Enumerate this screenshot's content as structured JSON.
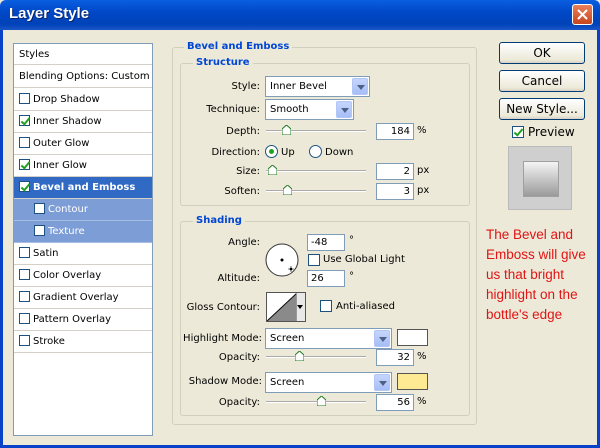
{
  "window": {
    "title": "Layer Style"
  },
  "sidebar": {
    "header": "Styles",
    "items": [
      {
        "label": "Blending Options: Custom",
        "checked": null
      },
      {
        "label": "Drop Shadow",
        "checked": false
      },
      {
        "label": "Inner Shadow",
        "checked": true
      },
      {
        "label": "Outer Glow",
        "checked": false
      },
      {
        "label": "Inner Glow",
        "checked": true
      },
      {
        "label": "Bevel and Emboss",
        "checked": true,
        "selected": true
      },
      {
        "label": "Contour",
        "checked": false,
        "sub": true
      },
      {
        "label": "Texture",
        "checked": false,
        "sub": true
      },
      {
        "label": "Satin",
        "checked": false
      },
      {
        "label": "Color Overlay",
        "checked": false
      },
      {
        "label": "Gradient Overlay",
        "checked": false
      },
      {
        "label": "Pattern Overlay",
        "checked": false
      },
      {
        "label": "Stroke",
        "checked": false
      }
    ]
  },
  "bevel": {
    "group_title": "Bevel and Emboss",
    "structure": {
      "title": "Structure",
      "style_label": "Style:",
      "style_value": "Inner Bevel",
      "technique_label": "Technique:",
      "technique_value": "Smooth",
      "depth_label": "Depth:",
      "depth_value": "184",
      "depth_unit": "%",
      "depth_slider": 0.18,
      "direction_label": "Direction:",
      "dir_up": "Up",
      "dir_down": "Down",
      "direction_selected": "Up",
      "size_label": "Size:",
      "size_value": "2",
      "size_unit": "px",
      "size_slider": 0.02,
      "soften_label": "Soften:",
      "soften_value": "3",
      "soften_unit": "px",
      "soften_slider": 0.19
    },
    "shading": {
      "title": "Shading",
      "angle_label": "Angle:",
      "angle_value": "-48",
      "angle_unit": "°",
      "global_light_label": "Use Global Light",
      "global_light": false,
      "altitude_label": "Altitude:",
      "altitude_value": "26",
      "altitude_unit": "°",
      "gloss_label": "Gloss Contour:",
      "antialiased_label": "Anti-aliased",
      "antialiased": false,
      "highlight_label": "Highlight Mode:",
      "highlight_value": "Screen",
      "highlight_color": "#ffffff",
      "hl_opacity_label": "Opacity:",
      "hl_opacity_value": "32",
      "hl_opacity_unit": "%",
      "hl_opacity_slider": 0.32,
      "shadow_label": "Shadow Mode:",
      "shadow_value": "Screen",
      "shadow_color": "#ffea94",
      "sh_opacity_label": "Opacity:",
      "sh_opacity_value": "56",
      "sh_opacity_unit": "%",
      "sh_opacity_slider": 0.56
    }
  },
  "buttons": {
    "ok": "OK",
    "cancel": "Cancel",
    "new_style": "New Style...",
    "preview_label": "Preview",
    "preview": true
  },
  "annotation": "The Bevel and Emboss will give us that bright highlight on the bottle's edge"
}
